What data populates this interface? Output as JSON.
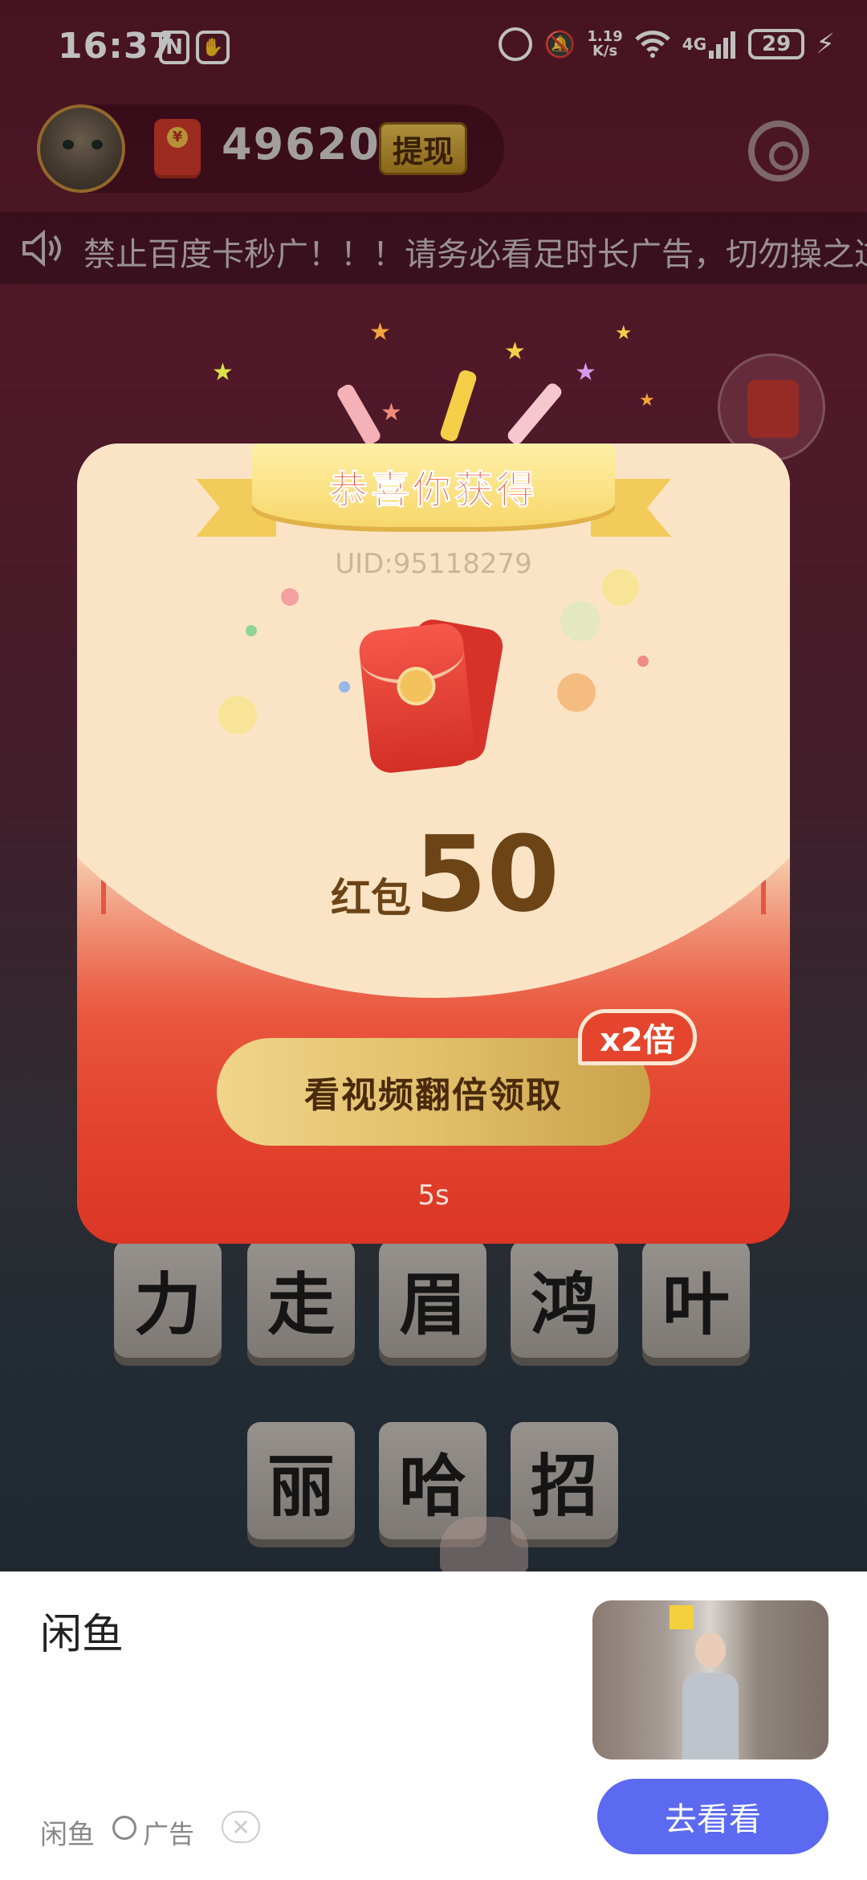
{
  "status_bar": {
    "time": "16:37",
    "net_speed_top": "1.19",
    "net_speed_bottom": "K/s",
    "network": "4G",
    "battery": "29"
  },
  "header": {
    "balance": "49620",
    "withdraw_label": "提现"
  },
  "notice": {
    "text": "禁止百度卡秒广！！！请务必看足时长广告，切勿操之过"
  },
  "tiles": {
    "row1": [
      "力",
      "走",
      "眉",
      "鸿",
      "叶"
    ],
    "row2": [
      "丽",
      "哈",
      "招"
    ]
  },
  "modal": {
    "title": "恭喜你获得",
    "uid": "UID:95118279",
    "amount_label": "红包",
    "amount_value": "50",
    "double_button": "看视频翻倍领取",
    "multiplier_badge": "x2倍",
    "countdown": "5s"
  },
  "ad": {
    "title": "闲鱼",
    "source": "闲鱼",
    "label": "广告",
    "cta": "去看看"
  },
  "colors": {
    "accent_red": "#dc3626",
    "gold": "#e2bf6a",
    "cta_blue": "#5b6af0"
  }
}
